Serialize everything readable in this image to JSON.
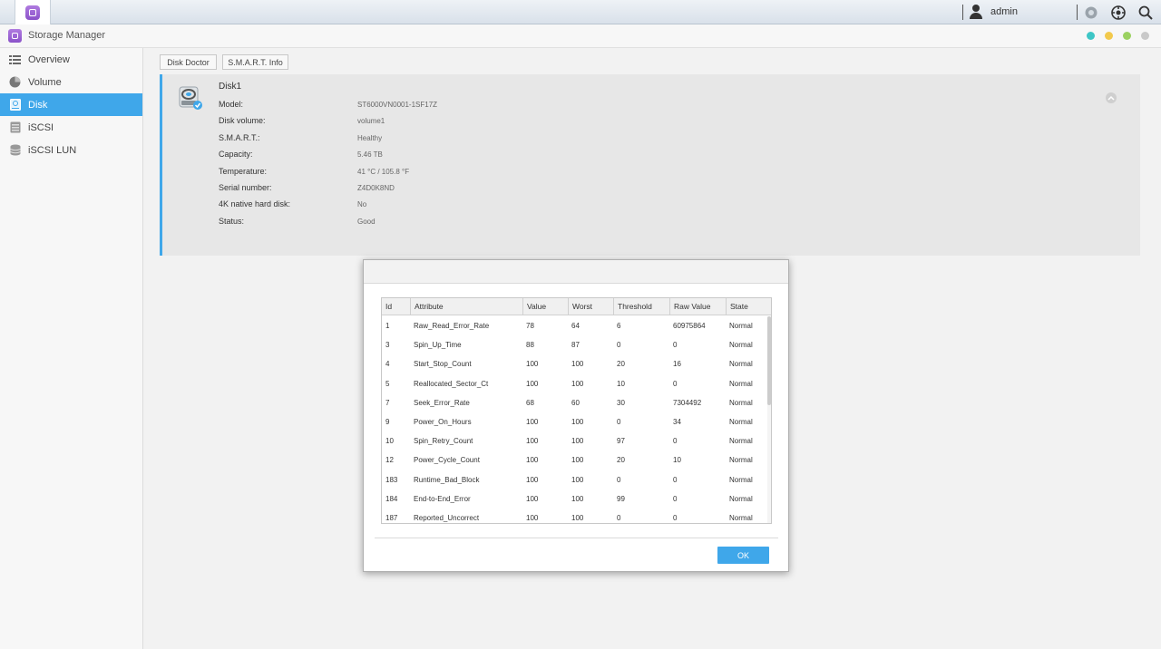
{
  "topbar": {
    "username": "admin",
    "icons": [
      "storage-manager-app-icon",
      "user-icon",
      "notification-icon",
      "settings-icon",
      "search-icon"
    ]
  },
  "window": {
    "title": "Storage Manager",
    "control_colors": [
      "#3ec6c6",
      "#f2c94c",
      "#9bd160",
      "#c9c9c9"
    ]
  },
  "sidebar": {
    "items": [
      {
        "label": "Overview",
        "icon": "list-icon",
        "active": false
      },
      {
        "label": "Volume",
        "icon": "pie-icon",
        "active": false
      },
      {
        "label": "Disk",
        "icon": "disk-icon",
        "active": true
      },
      {
        "label": "iSCSI",
        "icon": "iscsi-icon",
        "active": false
      },
      {
        "label": "iSCSI LUN",
        "icon": "database-icon",
        "active": false
      }
    ]
  },
  "toolbar": {
    "disk_doctor": "Disk Doctor",
    "smart_info": "S.M.A.R.T. Info"
  },
  "disk": {
    "name": "Disk1",
    "fields": [
      {
        "label": "Model:",
        "value": "ST6000VN0001-1SF17Z"
      },
      {
        "label": "Disk volume:",
        "value": "volume1"
      },
      {
        "label": "S.M.A.R.T.:",
        "value": "Healthy"
      },
      {
        "label": "Capacity:",
        "value": "5.46 TB"
      },
      {
        "label": "Temperature:",
        "value": "41 °C / 105.8 °F"
      },
      {
        "label": "Serial number:",
        "value": "Z4D0K8ND"
      },
      {
        "label": "4K native hard disk:",
        "value": "No"
      },
      {
        "label": "Status:",
        "value": "Good"
      }
    ]
  },
  "dialog": {
    "columns": [
      "Id",
      "Attribute",
      "Value",
      "Worst",
      "Threshold",
      "Raw Value",
      "State"
    ],
    "rows": [
      [
        "1",
        "Raw_Read_Error_Rate",
        "78",
        "64",
        "6",
        "60975864",
        "Normal"
      ],
      [
        "3",
        "Spin_Up_Time",
        "88",
        "87",
        "0",
        "0",
        "Normal"
      ],
      [
        "4",
        "Start_Stop_Count",
        "100",
        "100",
        "20",
        "16",
        "Normal"
      ],
      [
        "5",
        "Reallocated_Sector_Ct",
        "100",
        "100",
        "10",
        "0",
        "Normal"
      ],
      [
        "7",
        "Seek_Error_Rate",
        "68",
        "60",
        "30",
        "7304492",
        "Normal"
      ],
      [
        "9",
        "Power_On_Hours",
        "100",
        "100",
        "0",
        "34",
        "Normal"
      ],
      [
        "10",
        "Spin_Retry_Count",
        "100",
        "100",
        "97",
        "0",
        "Normal"
      ],
      [
        "12",
        "Power_Cycle_Count",
        "100",
        "100",
        "20",
        "10",
        "Normal"
      ],
      [
        "183",
        "Runtime_Bad_Block",
        "100",
        "100",
        "0",
        "0",
        "Normal"
      ],
      [
        "184",
        "End-to-End_Error",
        "100",
        "100",
        "99",
        "0",
        "Normal"
      ],
      [
        "187",
        "Reported_Uncorrect",
        "100",
        "100",
        "0",
        "0",
        "Normal"
      ]
    ],
    "ok_label": "OK"
  }
}
